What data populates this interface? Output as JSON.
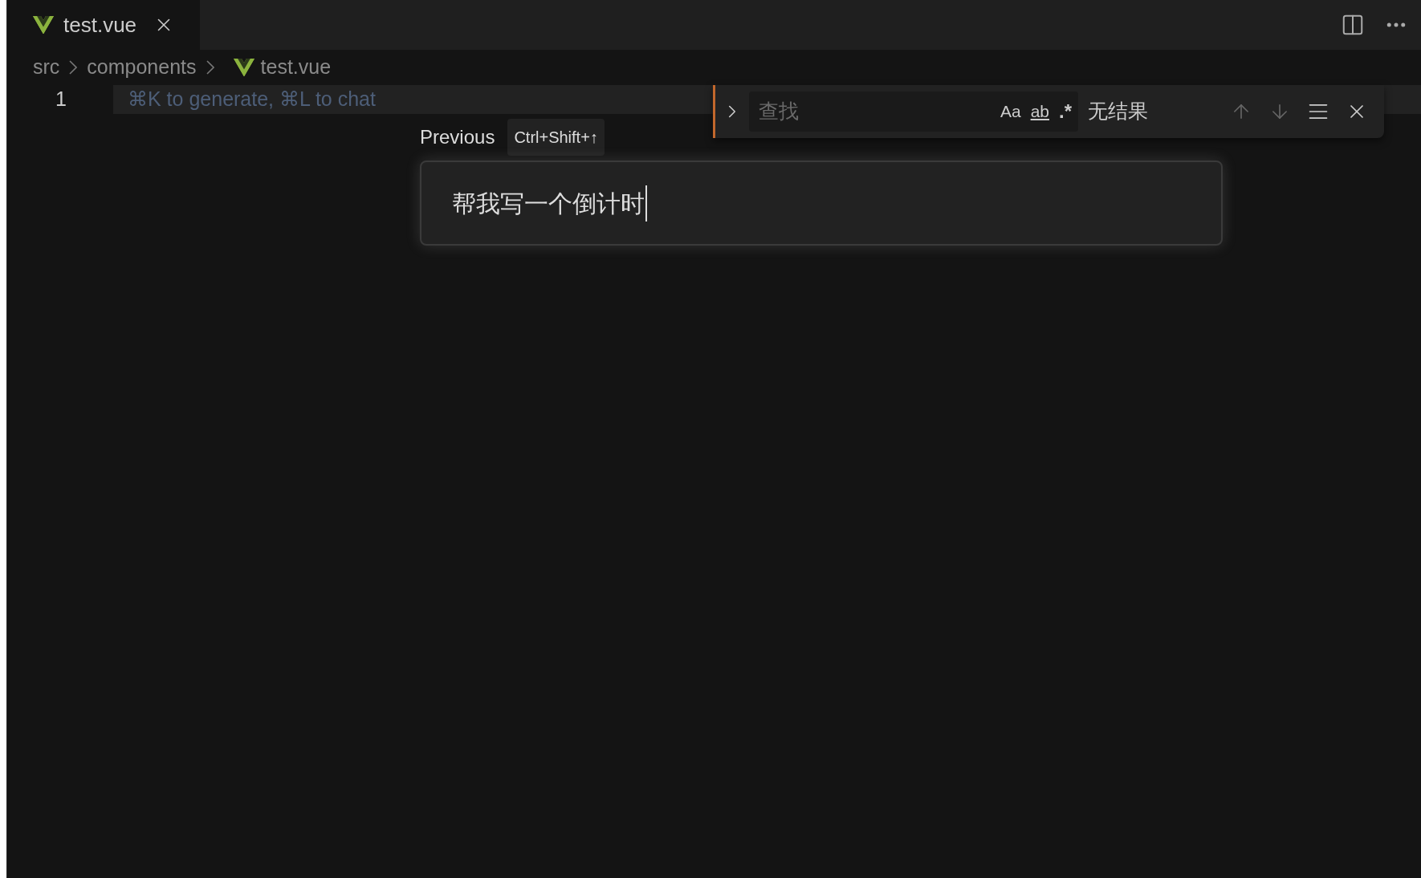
{
  "tabs": [
    {
      "label": "test.vue",
      "selected": true
    }
  ],
  "breadcrumb": [
    {
      "label": "src",
      "kind": "folder"
    },
    {
      "label": "components",
      "kind": "folder"
    },
    {
      "label": "test.vue",
      "kind": "file"
    }
  ],
  "editor": {
    "line_numbers": [
      "1"
    ],
    "hint": "⌘K to generate, ⌘L to chat"
  },
  "find_widget": {
    "placeholder": "查找",
    "toggles": [
      "Aa",
      "ab",
      ".*"
    ],
    "result": "无结果"
  },
  "prompt": {
    "history_label": "Previous",
    "shortcut": "Ctrl+Shift+↑",
    "value": "帮我写一个倒计时"
  }
}
